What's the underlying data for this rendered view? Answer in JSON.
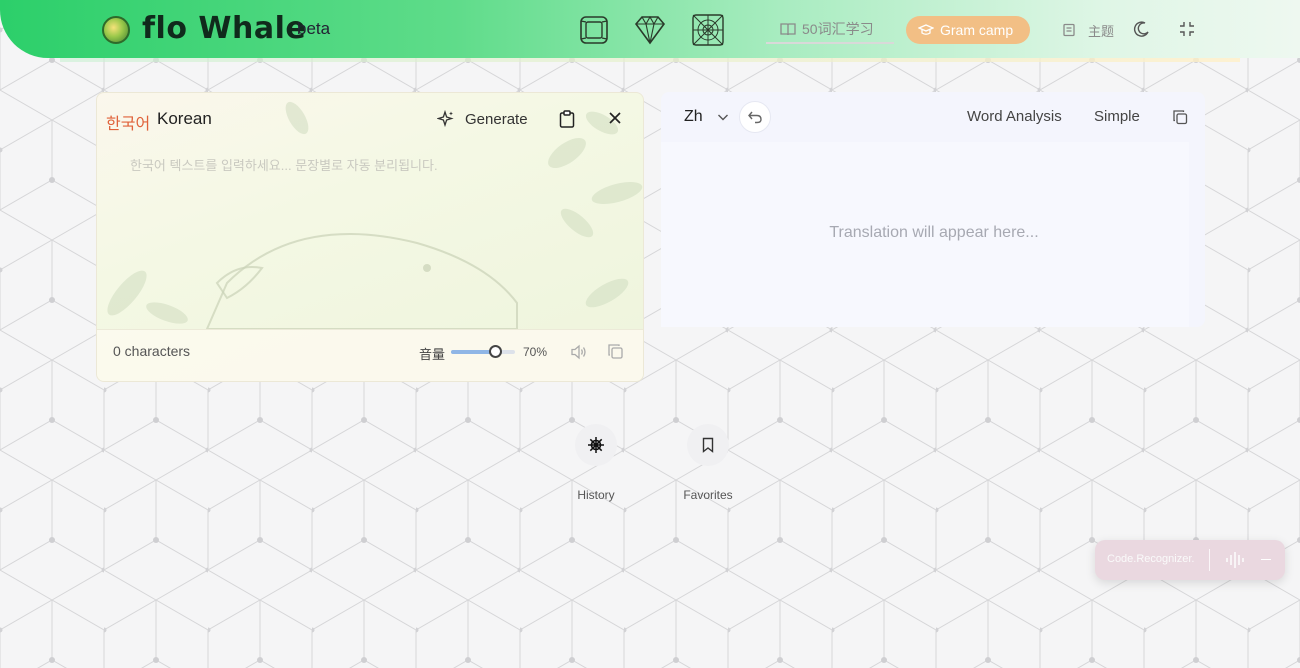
{
  "header": {
    "logo_text": "flo Whale",
    "badge": "beta",
    "vocab_label": "50词汇学习",
    "gram_camp_label": "Gram camp",
    "theme_label": "主题",
    "icons": [
      "frame-icon",
      "diamond-icon",
      "spiderweb-icon",
      "book-icon",
      "graduation-cap-icon",
      "palette-icon",
      "moon-icon",
      "collapse-icon"
    ]
  },
  "source": {
    "lang_native": "한국어",
    "lang_english": "Korean",
    "generate_label": "Generate",
    "placeholder": "한국어 텍스트를 입력하세요... 문장별로 자동 분리됩니다.",
    "char_count": "0 characters",
    "volume_label": "音量",
    "volume_percent": "70%",
    "volume_value": 0.7
  },
  "target": {
    "lang_code": "Zh",
    "word_analysis_label": "Word Analysis",
    "mode_label": "Simple",
    "placeholder": "Translation will appear here..."
  },
  "actions": {
    "history_label": "History",
    "favorites_label": "Favorites"
  },
  "floater": {
    "text": "Code.Recognizer."
  }
}
